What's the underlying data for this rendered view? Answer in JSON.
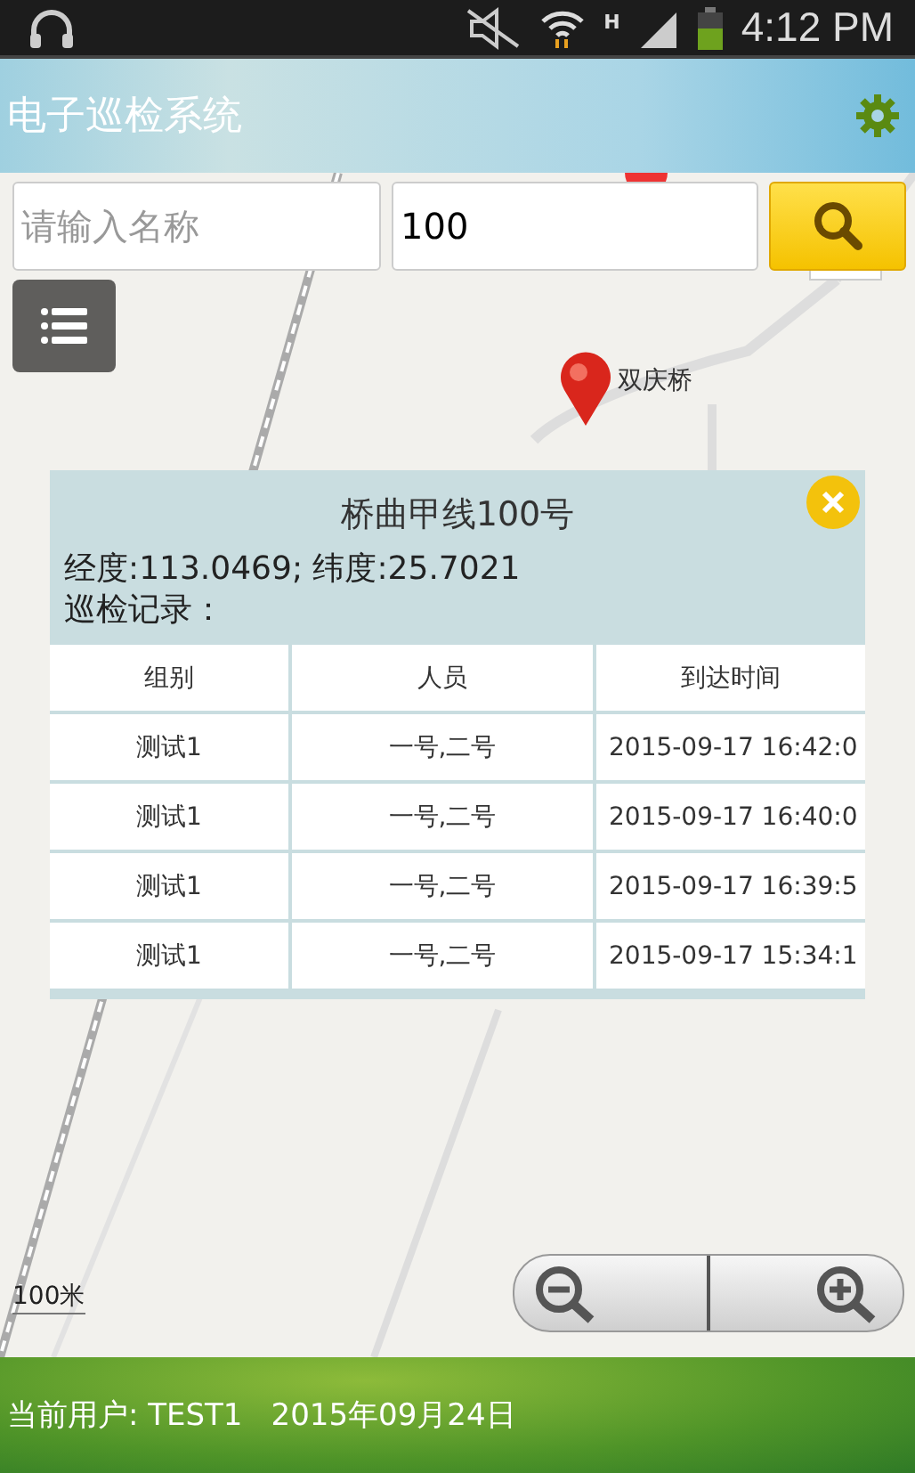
{
  "status_bar": {
    "network": "H",
    "time": "4:12 PM"
  },
  "header": {
    "title": "电子巡检系统"
  },
  "search": {
    "name_placeholder": "请输入名称",
    "number_value": "100"
  },
  "map": {
    "marker_label": "双庆桥",
    "scale": "100米"
  },
  "popup": {
    "title": "桥曲甲线100号",
    "coords": "经度:113.0469; 纬度:25.7021",
    "records_label": "巡检记录：",
    "columns": [
      "组别",
      "人员",
      "到达时间"
    ],
    "rows": [
      [
        "测试1",
        "一号,二号",
        "2015-09-17 16:42:0"
      ],
      [
        "测试1",
        "一号,二号",
        "2015-09-17 16:40:0"
      ],
      [
        "测试1",
        "一号,二号",
        "2015-09-17 16:39:5"
      ],
      [
        "测试1",
        "一号,二号",
        "2015-09-17 15:34:1"
      ]
    ]
  },
  "footer": {
    "user": "当前用户: TEST1",
    "date": "2015年09月24日"
  }
}
